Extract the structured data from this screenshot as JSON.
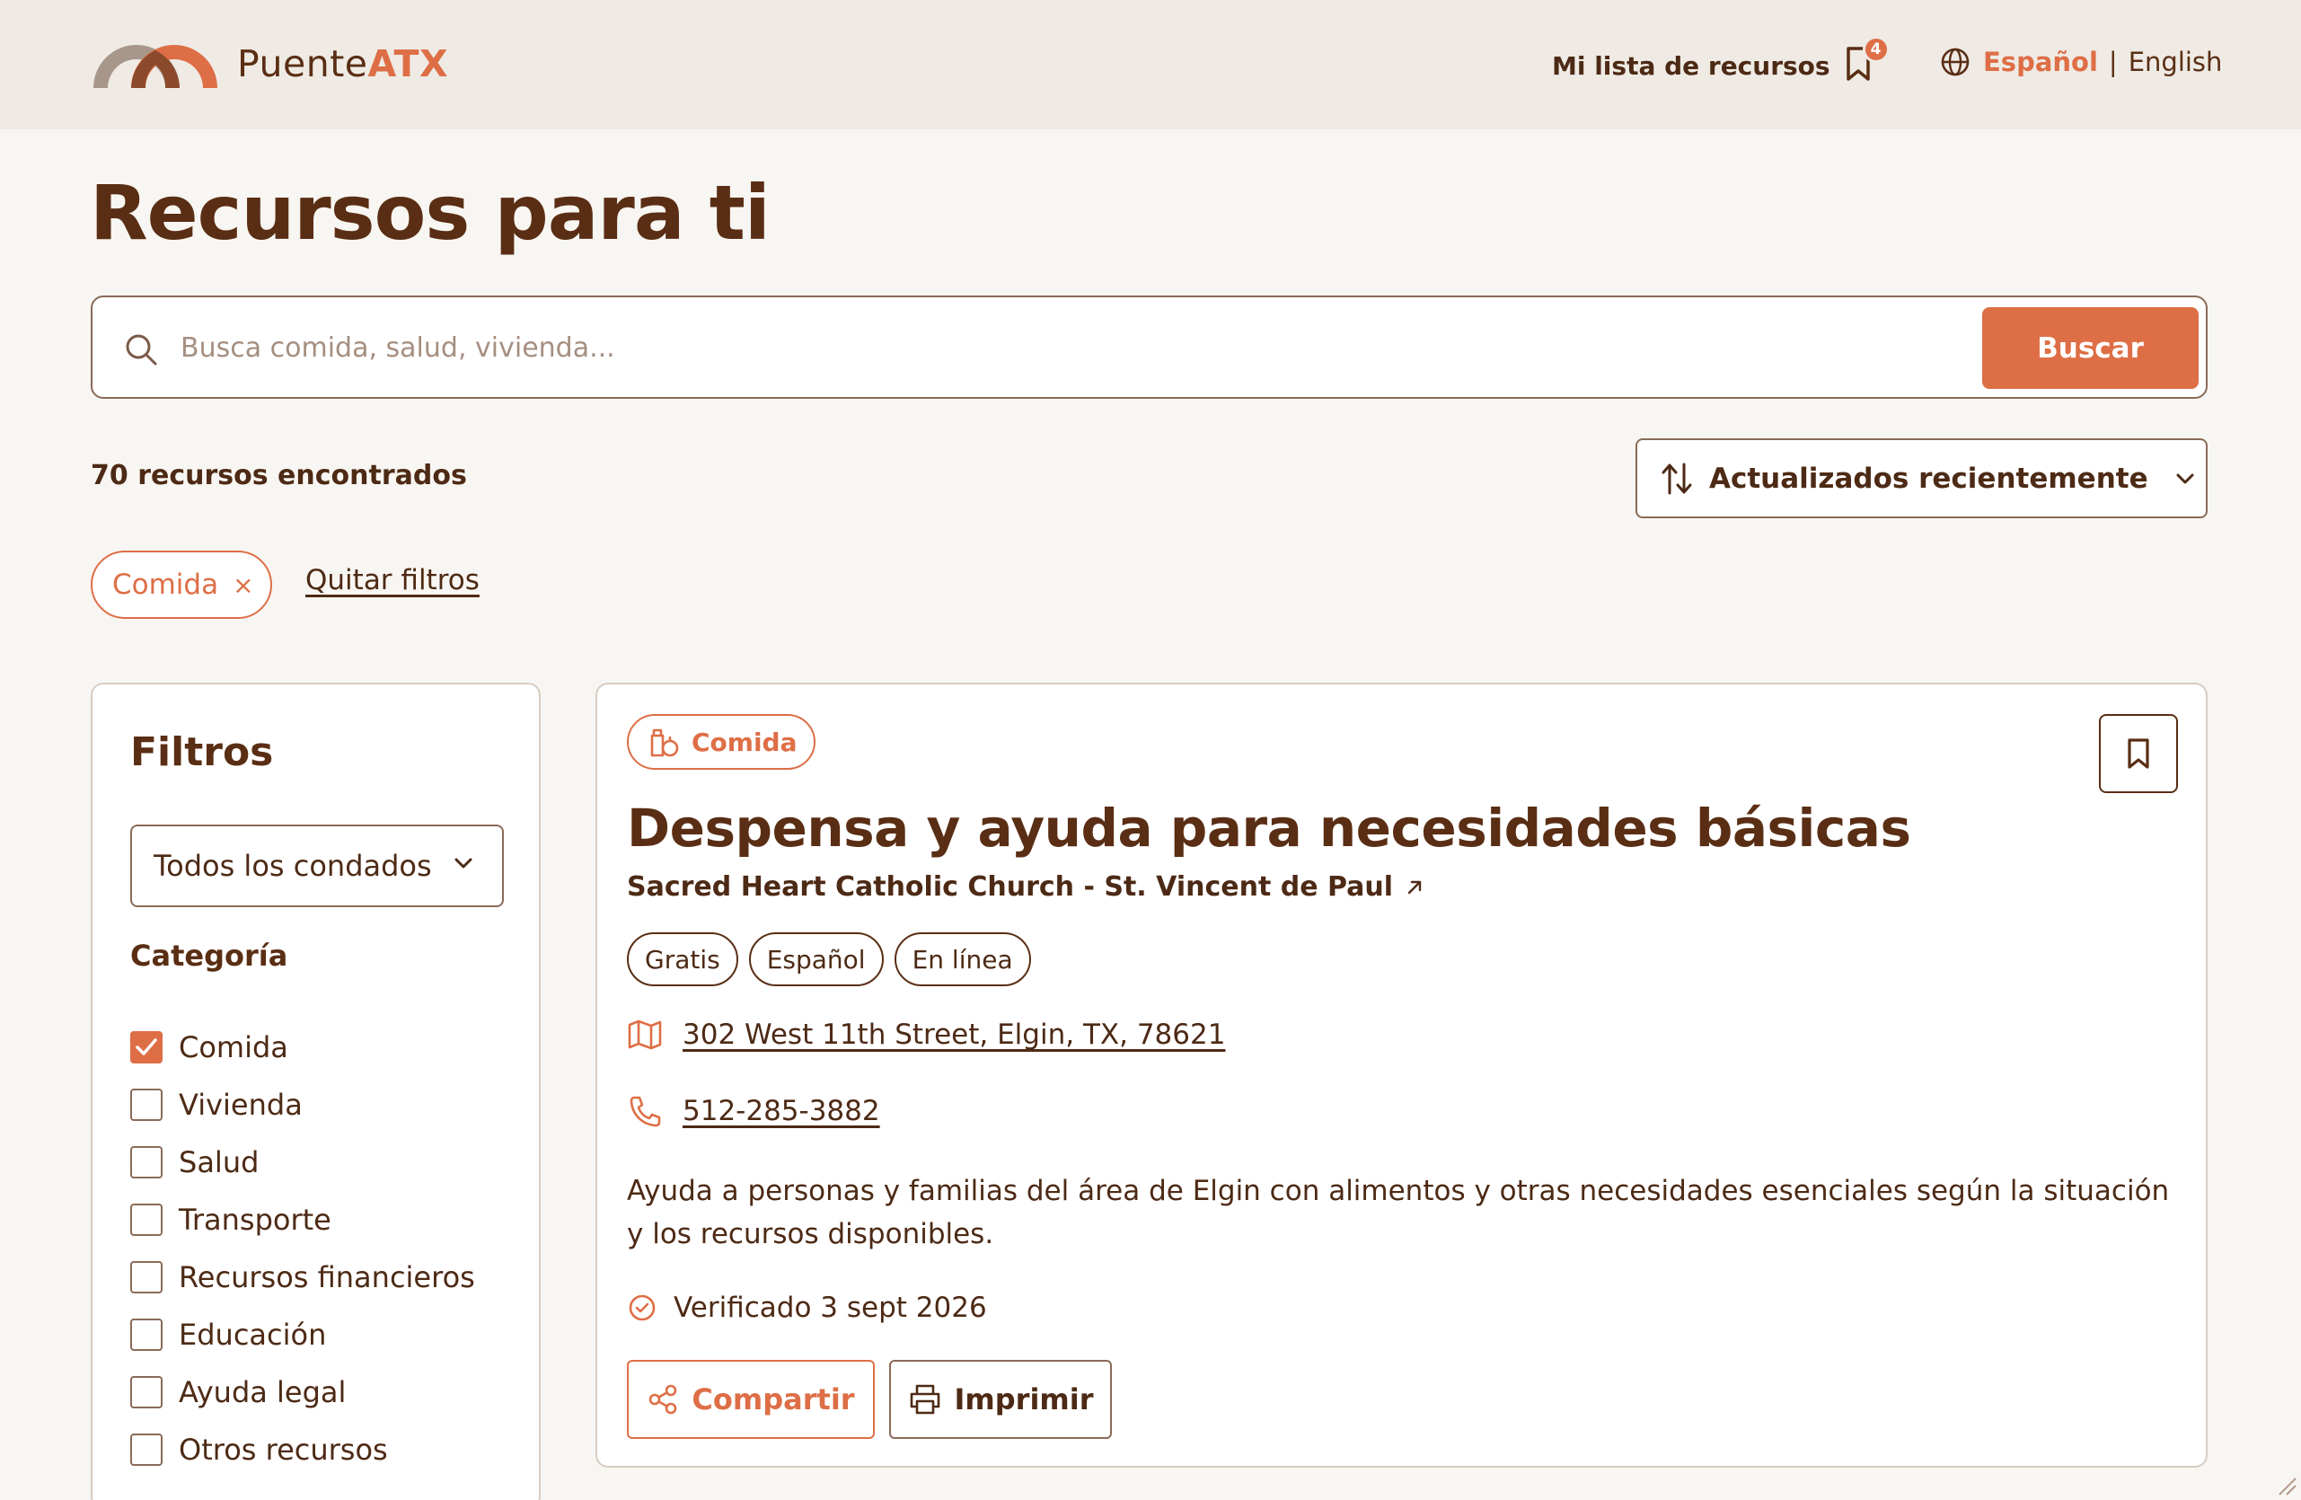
{
  "header": {
    "brand_main": "Puente",
    "brand_accent": "ATX",
    "my_list_label": "Mi lista de recursos",
    "my_list_count": "4",
    "lang_active": "Español",
    "lang_separator": "|",
    "lang_other": "English"
  },
  "page": {
    "title": "Recursos para ti"
  },
  "search": {
    "placeholder": "Busca comida, salud, vivienda...",
    "value": "",
    "button_label": "Buscar"
  },
  "results": {
    "count_label": "70 recursos encontrados"
  },
  "sort": {
    "selected": "Actualizados recientemente"
  },
  "active_filters": {
    "chips": [
      {
        "label": "Comida",
        "remove": "×"
      }
    ],
    "clear_label": "Quitar filtros"
  },
  "sidebar": {
    "title": "Filtros",
    "county_selected": "Todos los condados",
    "category_title": "Categoría",
    "categories": [
      {
        "label": "Comida",
        "checked": true
      },
      {
        "label": "Vivienda",
        "checked": false
      },
      {
        "label": "Salud",
        "checked": false
      },
      {
        "label": "Transporte",
        "checked": false
      },
      {
        "label": "Recursos financieros",
        "checked": false
      },
      {
        "label": "Educación",
        "checked": false
      },
      {
        "label": "Ayuda legal",
        "checked": false
      },
      {
        "label": "Otros recursos",
        "checked": false
      }
    ]
  },
  "card": {
    "category": "Comida",
    "category_icon": "food-icon",
    "title": "Despensa y ayuda para necesidades básicas",
    "organization": "Sacred Heart Catholic Church - St. Vincent de Paul",
    "tags": [
      "Gratis",
      "Español",
      "En línea"
    ],
    "address": "302 West 11th Street, Elgin, TX, 78621",
    "phone": "512-285-3882",
    "description": "Ayuda a personas y familias del área de Elgin con alimentos y otras necesidades esenciales según la situación y los recursos disponibles.",
    "verified": "Verificado 3 sept 2026",
    "share_label": "Compartir",
    "print_label": "Imprimir"
  },
  "colors": {
    "accent": "#de6e46",
    "text": "#5a2e14",
    "background": "#f8f6f2",
    "header_bg": "#efebe4"
  }
}
